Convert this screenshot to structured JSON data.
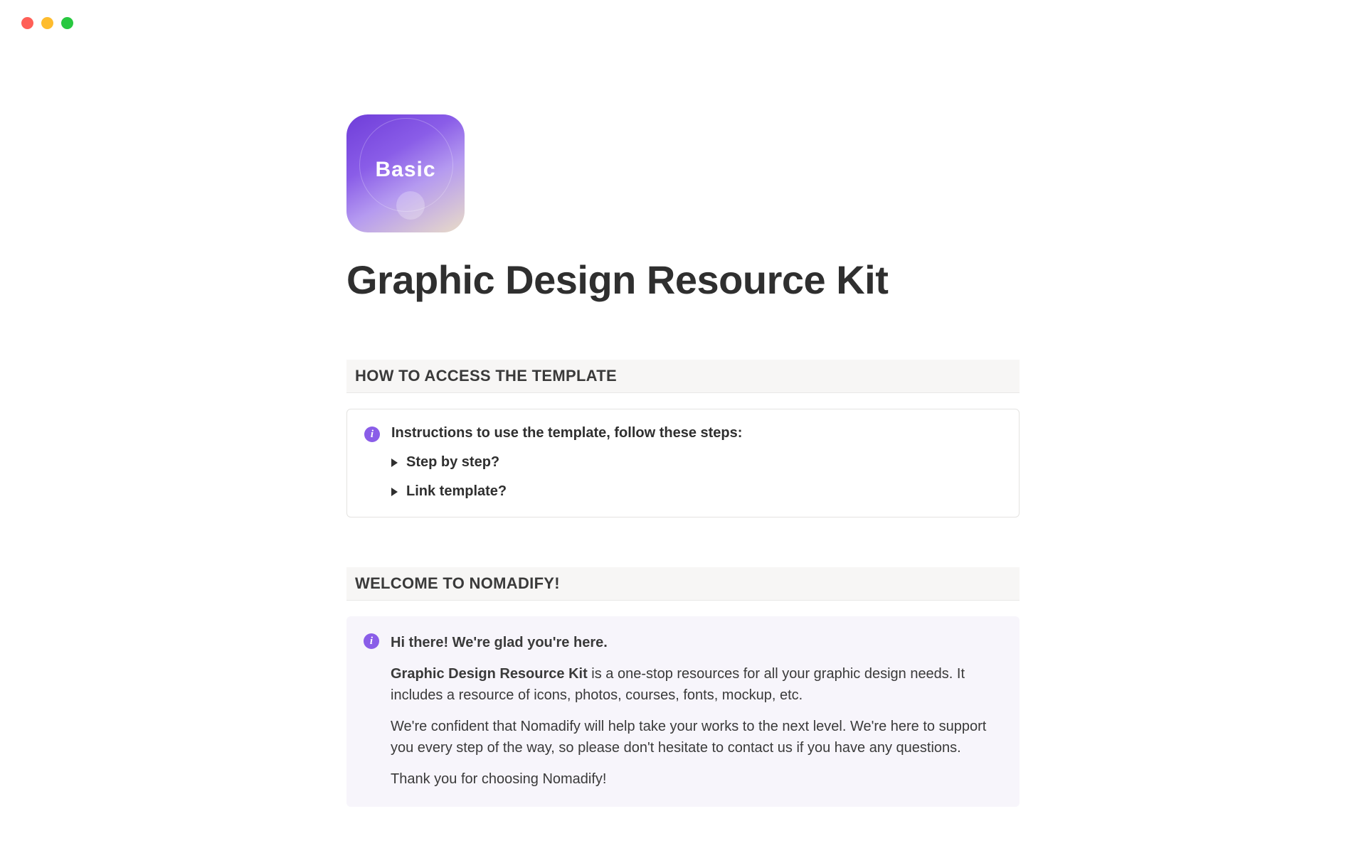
{
  "badge": {
    "label": "Basic"
  },
  "title": "Graphic Design Resource Kit",
  "sections": {
    "access": {
      "header": "HOW TO ACCESS THE TEMPLATE",
      "callout": {
        "heading": "Instructions to use the template, follow these steps:",
        "toggles": [
          {
            "label": "Step by step?"
          },
          {
            "label": "Link template?"
          }
        ]
      }
    },
    "welcome": {
      "header": "WELCOME TO NOMADIFY!",
      "callout": {
        "greeting": "Hi there! We're glad you're here.",
        "intro_bold": "Graphic Design Resource Kit",
        "intro_rest": " is a one-stop resources for all your graphic design needs. It includes a resource of icons, photos, courses, fonts, mockup, etc.",
        "confidence": "We're confident that Nomadify will help take your works to the next level. We're here to support you every step of the way, so please don't hesitate to contact us if you have any questions.",
        "thanks": "Thank you for choosing Nomadify!"
      }
    }
  }
}
